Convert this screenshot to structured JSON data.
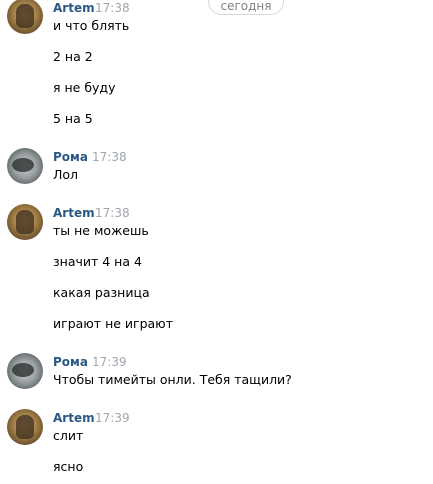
{
  "date_divider": "сегодня",
  "messages": [
    {
      "author": "Artem",
      "time": "17:38",
      "lines": [
        "и что блять",
        "2 на 2",
        "я не буду",
        "5 на 5"
      ]
    },
    {
      "author": "Рома",
      "time": "17:38",
      "lines": [
        "Лол"
      ]
    },
    {
      "author": "Artem",
      "time": "17:38",
      "lines": [
        "ты не можешь",
        "значит 4 на 4",
        "какая разница",
        "играют не играют"
      ]
    },
    {
      "author": "Рома",
      "time": "17:39",
      "lines": [
        "Чтобы тимейты онли. Тебя тащили?"
      ]
    },
    {
      "author": "Artem",
      "time": "17:39",
      "lines": [
        "слит",
        "ясно"
      ]
    }
  ]
}
